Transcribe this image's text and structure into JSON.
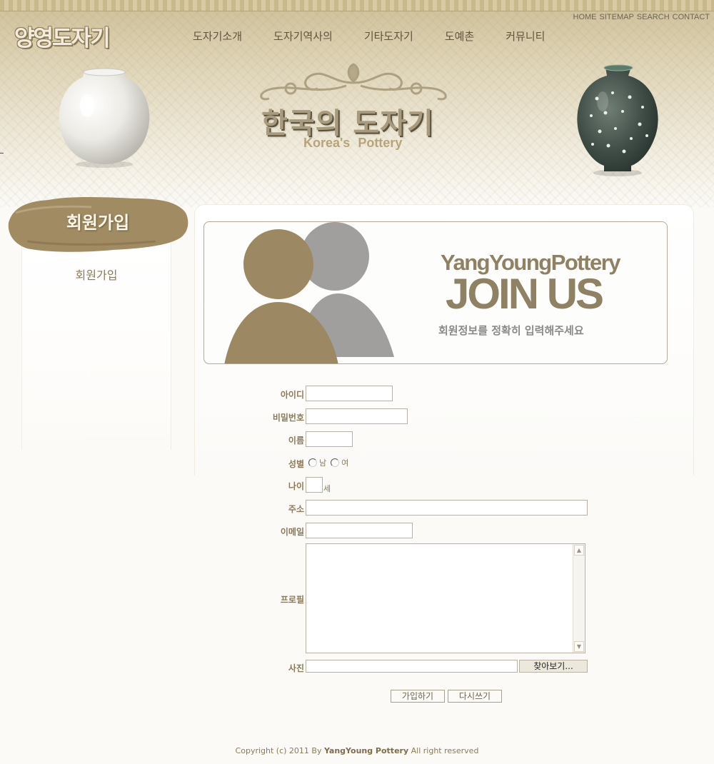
{
  "header": {
    "logo": "양영도자기",
    "util_links": [
      "HOME",
      "SITEMAP",
      "SEARCH",
      "CONTACT"
    ],
    "nav": [
      "도자기소개",
      "도자기역사의",
      "기타도자기",
      "도예촌",
      "커뮤니티"
    ],
    "hero_title": "한국의 도자기",
    "hero_subtitle": "Korea's Pottery"
  },
  "sidebar": {
    "title": "회원가입",
    "items": [
      "회원가입"
    ]
  },
  "banner": {
    "brand": "YangYoungPottery",
    "headline": "JOIN US",
    "message": "회원정보를 정확히 입력해주세요"
  },
  "form": {
    "id_label": "아이디",
    "password_label": "비밀번호",
    "name_label": "이름",
    "gender_label": "성별",
    "gender_options": [
      "남",
      "여"
    ],
    "age_label": "나이",
    "age_unit": "세",
    "address_label": "주소",
    "email_label": "이메일",
    "profile_label": "프로필",
    "photo_label": "사진",
    "browse_button": "찾아보기...",
    "submit_button": "가입하기",
    "reset_button": "다시쓰기"
  },
  "footer": {
    "prefix": "Copyright (c) 2011 By ",
    "brand": "YangYoung Pottery",
    "suffix": " All right reserved"
  },
  "colors": {
    "accent": "#9b8762",
    "person_front": "#9c8863",
    "person_back": "#a19f9d"
  }
}
